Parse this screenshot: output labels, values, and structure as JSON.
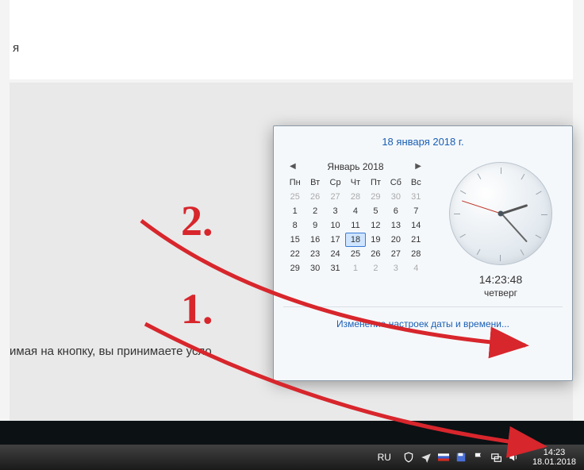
{
  "page": {
    "truncated1": "я",
    "footer_text": "имая на кнопку, вы принимаете усло"
  },
  "popup": {
    "date_header": "18 января 2018 г.",
    "month_title": "Январь 2018",
    "dow": [
      "Пн",
      "Вт",
      "Ср",
      "Чт",
      "Пт",
      "Сб",
      "Вс"
    ],
    "days": [
      {
        "d": "25",
        "m": true
      },
      {
        "d": "26",
        "m": true
      },
      {
        "d": "27",
        "m": true
      },
      {
        "d": "28",
        "m": true
      },
      {
        "d": "29",
        "m": true
      },
      {
        "d": "30",
        "m": true
      },
      {
        "d": "31",
        "m": true
      },
      {
        "d": "1"
      },
      {
        "d": "2"
      },
      {
        "d": "3"
      },
      {
        "d": "4"
      },
      {
        "d": "5"
      },
      {
        "d": "6"
      },
      {
        "d": "7"
      },
      {
        "d": "8"
      },
      {
        "d": "9"
      },
      {
        "d": "10"
      },
      {
        "d": "11"
      },
      {
        "d": "12"
      },
      {
        "d": "13"
      },
      {
        "d": "14"
      },
      {
        "d": "15"
      },
      {
        "d": "16"
      },
      {
        "d": "17"
      },
      {
        "d": "18",
        "sel": true
      },
      {
        "d": "19"
      },
      {
        "d": "20"
      },
      {
        "d": "21"
      },
      {
        "d": "22"
      },
      {
        "d": "23"
      },
      {
        "d": "24"
      },
      {
        "d": "25"
      },
      {
        "d": "26"
      },
      {
        "d": "27"
      },
      {
        "d": "28"
      },
      {
        "d": "29"
      },
      {
        "d": "30"
      },
      {
        "d": "31"
      },
      {
        "d": "1",
        "m": true
      },
      {
        "d": "2",
        "m": true
      },
      {
        "d": "3",
        "m": true
      },
      {
        "d": "4",
        "m": true
      }
    ],
    "clock_time": "14:23:48",
    "clock_dow": "четверг",
    "settings_link": "Изменение настроек даты и времени..."
  },
  "taskbar": {
    "lang": "RU",
    "time": "14:23",
    "date": "18.01.2018"
  },
  "annotations": {
    "num1": "1.",
    "num2": "2."
  }
}
